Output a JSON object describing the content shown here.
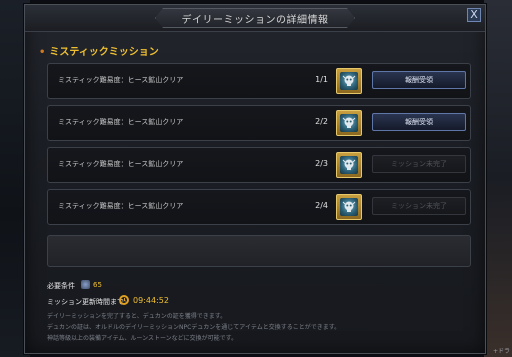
{
  "window": {
    "title": "デイリーミッションの詳細情報",
    "close_label": "X"
  },
  "section": {
    "title": "ミスティックミッション"
  },
  "missions": [
    {
      "label": "ミスティック難易度：ヒース鉱山クリア",
      "progress": "1/1",
      "button": "報酬受領",
      "button_enabled": true
    },
    {
      "label": "ミスティック難易度：ヒース鉱山クリア",
      "progress": "2/2",
      "button": "報酬受領",
      "button_enabled": true
    },
    {
      "label": "ミスティック難易度：ヒース鉱山クリア",
      "progress": "2/3",
      "button": "ミッション未完了",
      "button_enabled": false
    },
    {
      "label": "ミスティック難易度：ヒース鉱山クリア",
      "progress": "2/4",
      "button": "ミッション未完了",
      "button_enabled": false
    }
  ],
  "requirements": {
    "label": "必要条件",
    "value": "65"
  },
  "reset": {
    "label": "ミッション更新時間まで:",
    "time": "09:44:52"
  },
  "notes": [
    "デイリーミッションを完了すると、デュカンの証を獲得できます。",
    "デュカンの証は、オルドルのデイリーミッションNPCデュカンを通じてアイテムと交換することができます。",
    "神話等級以上の装備アイテム、ルーンストーンなどに交換が可能です。"
  ],
  "corner_text": "+ドラ",
  "colors": {
    "accent": "#f0c030",
    "button_border": "#5f77a8"
  }
}
